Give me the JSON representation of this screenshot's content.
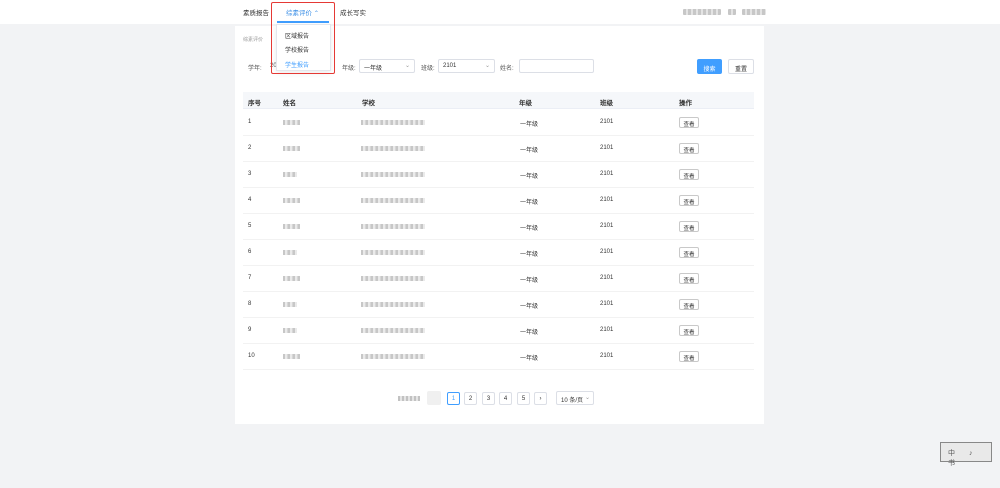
{
  "nav": {
    "items": [
      {
        "label": "素质报告"
      },
      {
        "label": "综素评价"
      },
      {
        "label": "成长写实"
      }
    ],
    "active_caret": "⌃"
  },
  "breadcrumb": "综素评价",
  "dropdown": {
    "items": [
      {
        "label": "区域报告"
      },
      {
        "label": "学校报告"
      },
      {
        "label": "学生报告",
        "active": true
      }
    ]
  },
  "filters": {
    "year_label": "学年:",
    "year_value": "20",
    "grade_label": "年级:",
    "grade_value": "一年级",
    "class_label": "班级:",
    "class_value": "2101",
    "name_label": "姓名:",
    "name_value": "",
    "search_button": "搜索",
    "reset_button": "重置"
  },
  "table": {
    "columns": [
      "序号",
      "姓名",
      "学校",
      "年级",
      "班级",
      "操作"
    ],
    "rows": [
      {
        "index": "1",
        "grade": "一年级",
        "class": "2101",
        "action": "查看"
      },
      {
        "index": "2",
        "grade": "一年级",
        "class": "2101",
        "action": "查看"
      },
      {
        "index": "3",
        "grade": "一年级",
        "class": "2101",
        "action": "查看"
      },
      {
        "index": "4",
        "grade": "一年级",
        "class": "2101",
        "action": "查看"
      },
      {
        "index": "5",
        "grade": "一年级",
        "class": "2101",
        "action": "查看"
      },
      {
        "index": "6",
        "grade": "一年级",
        "class": "2101",
        "action": "查看"
      },
      {
        "index": "7",
        "grade": "一年级",
        "class": "2101",
        "action": "查看"
      },
      {
        "index": "8",
        "grade": "一年级",
        "class": "2101",
        "action": "查看"
      },
      {
        "index": "9",
        "grade": "一年级",
        "class": "2101",
        "action": "查看"
      },
      {
        "index": "10",
        "grade": "一年级",
        "class": "2101",
        "action": "查看"
      }
    ]
  },
  "pagination": {
    "pages": [
      "1",
      "2",
      "3",
      "4",
      "5"
    ],
    "current": "1",
    "next": "›",
    "page_size": "10 条/页"
  },
  "stamp": "中 ♪ 书",
  "colors": {
    "accent": "#409eff",
    "highlight": "#e53935"
  }
}
